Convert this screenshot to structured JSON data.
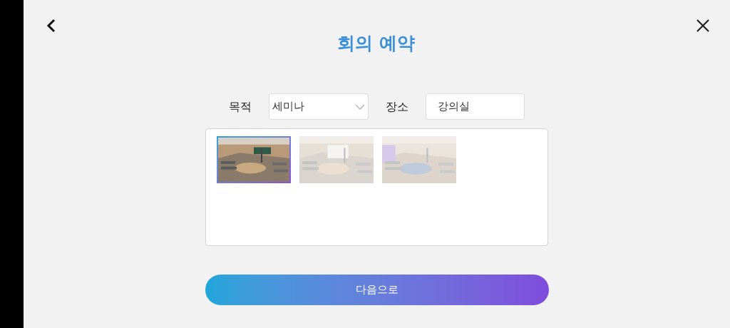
{
  "header": {
    "title": "회의 예약"
  },
  "form": {
    "purpose_label": "목적",
    "purpose_value": "세미나",
    "place_label": "장소",
    "place_value": "강의실"
  },
  "rooms": [
    {
      "kind": "picture",
      "selected": true
    },
    {
      "kind": "picture",
      "selected": false
    },
    {
      "kind": "picture",
      "selected": false
    }
  ],
  "next_button": "다음으로"
}
